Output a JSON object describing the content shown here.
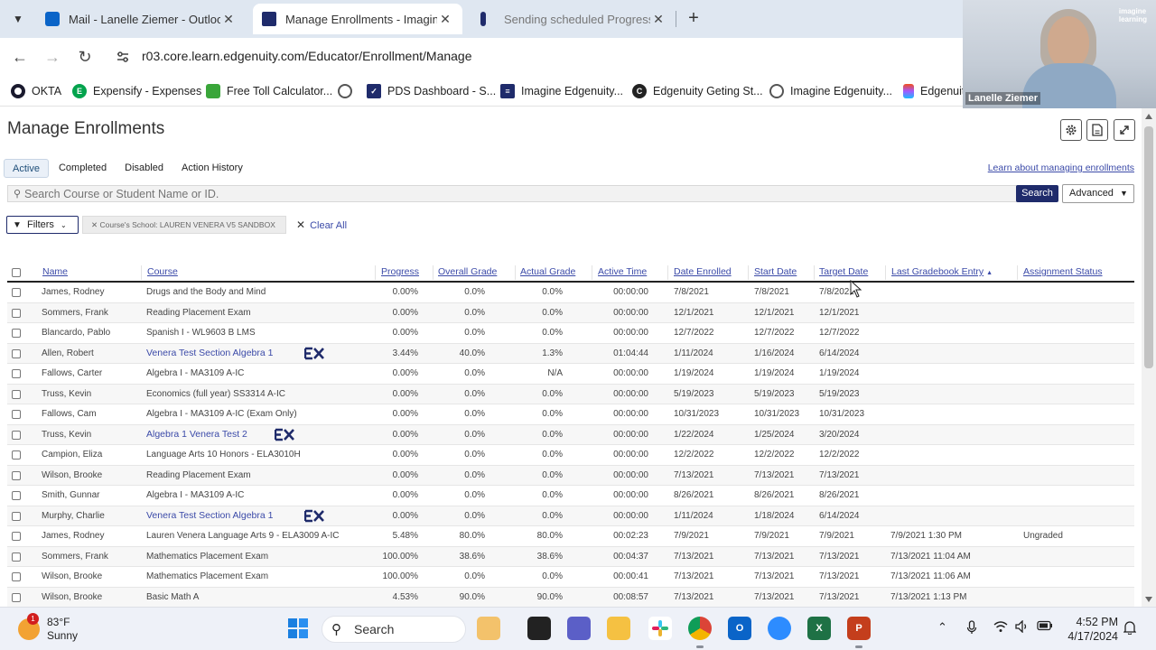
{
  "browser": {
    "tabs": [
      {
        "label": "Mail - Lanelle Ziemer - Outlook",
        "active": false,
        "icon": "outlook-icon"
      },
      {
        "label": "Manage Enrollments - Imagine",
        "active": true,
        "icon": "imagine-edgenuity-icon"
      },
      {
        "label": "Sending scheduled Progress Re",
        "active": false,
        "icon": "document-icon"
      }
    ],
    "url": "r03.core.learn.edgenuity.com/Educator/Enrollment/Manage",
    "bookmarks": [
      {
        "label": "OKTA",
        "icon": "okta-icon"
      },
      {
        "label": "Expensify - Expenses",
        "icon": "expensify-icon"
      },
      {
        "label": "Free Toll Calculator...",
        "icon": "toll-calculator-icon"
      },
      {
        "label": "",
        "icon": "globe-icon"
      },
      {
        "label": "PDS Dashboard - S...",
        "icon": "pds-dashboard-icon"
      },
      {
        "label": "Imagine Edgenuity...",
        "icon": "imagine-edgenuity-icon"
      },
      {
        "label": "Edgenuity Geting St...",
        "icon": "edgenuity-c-icon"
      },
      {
        "label": "Imagine Edgenuity...",
        "icon": "globe-icon"
      },
      {
        "label": "Edgenuit",
        "icon": "figma-icon"
      }
    ]
  },
  "webcam": {
    "name": "Lanelle Ziemer",
    "logo_line1": "imagine",
    "logo_line2": "learning"
  },
  "page": {
    "title": "Manage Enrollments",
    "tabs": [
      "Active",
      "Completed",
      "Disabled",
      "Action History"
    ],
    "learn_link": "Learn about managing enrollments",
    "search_placeholder": "Search Course or Student Name or ID.",
    "search_button": "Search",
    "advanced_button": "Advanced",
    "filters_button": "Filters",
    "filter_chip": "Course's School: LAUREN VENERA V5 SANDBOX",
    "clear_all": "Clear All"
  },
  "table": {
    "columns": [
      "Name",
      "Course",
      "Progress",
      "Overall Grade",
      "Actual Grade",
      "Active Time",
      "Date Enrolled",
      "Start Date",
      "Target Date",
      "Last Gradebook Entry",
      "Assignment Status"
    ],
    "sort_column": "Last Gradebook Entry",
    "rows": [
      {
        "name": "James, Rodney",
        "course": "Drugs and the Body and Mind",
        "course_link": false,
        "ex": false,
        "progress": "0.00%",
        "overall": "0.0%",
        "actual": "0.0%",
        "time": "00:00:00",
        "enrolled": "7/8/2021",
        "start": "7/8/2021",
        "target": "7/8/2021",
        "last": "",
        "status": ""
      },
      {
        "name": "Sommers, Frank",
        "course": "Reading Placement Exam",
        "course_link": false,
        "ex": false,
        "progress": "0.00%",
        "overall": "0.0%",
        "actual": "0.0%",
        "time": "00:00:00",
        "enrolled": "12/1/2021",
        "start": "12/1/2021",
        "target": "12/1/2021",
        "last": "",
        "status": ""
      },
      {
        "name": "Blancardo, Pablo",
        "course": "Spanish I - WL9603 B LMS",
        "course_link": false,
        "ex": false,
        "progress": "0.00%",
        "overall": "0.0%",
        "actual": "0.0%",
        "time": "00:00:00",
        "enrolled": "12/7/2022",
        "start": "12/7/2022",
        "target": "12/7/2022",
        "last": "",
        "status": ""
      },
      {
        "name": "Allen, Robert",
        "course": "Venera Test Section Algebra 1",
        "course_link": true,
        "ex": true,
        "progress": "3.44%",
        "overall": "40.0%",
        "actual": "1.3%",
        "time": "01:04:44",
        "enrolled": "1/11/2024",
        "start": "1/16/2024",
        "target": "6/14/2024",
        "last": "",
        "status": ""
      },
      {
        "name": "Fallows, Carter",
        "course": "Algebra I - MA3109 A-IC",
        "course_link": false,
        "ex": false,
        "progress": "0.00%",
        "overall": "0.0%",
        "actual": "N/A",
        "time": "00:00:00",
        "enrolled": "1/19/2024",
        "start": "1/19/2024",
        "target": "1/19/2024",
        "last": "",
        "status": ""
      },
      {
        "name": "Truss, Kevin",
        "course": "Economics (full year) SS3314 A-IC",
        "course_link": false,
        "ex": false,
        "progress": "0.00%",
        "overall": "0.0%",
        "actual": "0.0%",
        "time": "00:00:00",
        "enrolled": "5/19/2023",
        "start": "5/19/2023",
        "target": "5/19/2023",
        "last": "",
        "status": ""
      },
      {
        "name": "Fallows, Cam",
        "course": "Algebra I - MA3109 A-IC (Exam Only)",
        "course_link": false,
        "ex": false,
        "progress": "0.00%",
        "overall": "0.0%",
        "actual": "0.0%",
        "time": "00:00:00",
        "enrolled": "10/31/2023",
        "start": "10/31/2023",
        "target": "10/31/2023",
        "last": "",
        "status": ""
      },
      {
        "name": "Truss, Kevin",
        "course": "Algebra 1 Venera Test 2",
        "course_link": true,
        "ex": true,
        "progress": "0.00%",
        "overall": "0.0%",
        "actual": "0.0%",
        "time": "00:00:00",
        "enrolled": "1/22/2024",
        "start": "1/25/2024",
        "target": "3/20/2024",
        "last": "",
        "status": ""
      },
      {
        "name": "Campion, Eliza",
        "course": "Language Arts 10 Honors - ELA3010H",
        "course_link": false,
        "ex": false,
        "progress": "0.00%",
        "overall": "0.0%",
        "actual": "0.0%",
        "time": "00:00:00",
        "enrolled": "12/2/2022",
        "start": "12/2/2022",
        "target": "12/2/2022",
        "last": "",
        "status": ""
      },
      {
        "name": "Wilson, Brooke",
        "course": "Reading Placement Exam",
        "course_link": false,
        "ex": false,
        "progress": "0.00%",
        "overall": "0.0%",
        "actual": "0.0%",
        "time": "00:00:00",
        "enrolled": "7/13/2021",
        "start": "7/13/2021",
        "target": "7/13/2021",
        "last": "",
        "status": ""
      },
      {
        "name": "Smith, Gunnar",
        "course": "Algebra I - MA3109 A-IC",
        "course_link": false,
        "ex": false,
        "progress": "0.00%",
        "overall": "0.0%",
        "actual": "0.0%",
        "time": "00:00:00",
        "enrolled": "8/26/2021",
        "start": "8/26/2021",
        "target": "8/26/2021",
        "last": "",
        "status": ""
      },
      {
        "name": "Murphy, Charlie",
        "course": "Venera Test Section Algebra 1",
        "course_link": true,
        "ex": true,
        "progress": "0.00%",
        "overall": "0.0%",
        "actual": "0.0%",
        "time": "00:00:00",
        "enrolled": "1/11/2024",
        "start": "1/18/2024",
        "target": "6/14/2024",
        "last": "",
        "status": ""
      },
      {
        "name": "James, Rodney",
        "course": "Lauren Venera Language Arts 9 - ELA3009 A-IC",
        "course_link": false,
        "ex": false,
        "progress": "5.48%",
        "overall": "80.0%",
        "actual": "80.0%",
        "time": "00:02:23",
        "enrolled": "7/9/2021",
        "start": "7/9/2021",
        "target": "7/9/2021",
        "last": "7/9/2021 1:30 PM",
        "status": "Ungraded"
      },
      {
        "name": "Sommers, Frank",
        "course": "Mathematics Placement Exam",
        "course_link": false,
        "ex": false,
        "progress": "100.00%",
        "overall": "38.6%",
        "actual": "38.6%",
        "time": "00:04:37",
        "enrolled": "7/13/2021",
        "start": "7/13/2021",
        "target": "7/13/2021",
        "last": "7/13/2021 11:04 AM",
        "status": ""
      },
      {
        "name": "Wilson, Brooke",
        "course": "Mathematics Placement Exam",
        "course_link": false,
        "ex": false,
        "progress": "100.00%",
        "overall": "0.0%",
        "actual": "0.0%",
        "time": "00:00:41",
        "enrolled": "7/13/2021",
        "start": "7/13/2021",
        "target": "7/13/2021",
        "last": "7/13/2021 11:06 AM",
        "status": ""
      },
      {
        "name": "Wilson, Brooke",
        "course": "Basic Math A",
        "course_link": false,
        "ex": false,
        "progress": "4.53%",
        "overall": "90.0%",
        "actual": "90.0%",
        "time": "00:08:57",
        "enrolled": "7/13/2021",
        "start": "7/13/2021",
        "target": "7/13/2021",
        "last": "7/13/2021 1:13 PM",
        "status": ""
      }
    ]
  },
  "taskbar": {
    "weather_temp": "83°F",
    "weather_desc": "Sunny",
    "weather_badge": "1",
    "search_label": "Search",
    "time": "4:52 PM",
    "date": "4/17/2024",
    "apps": [
      "windows-start-icon",
      "search-icon",
      "paint-icon",
      "file-explorer-icon",
      "teams-icon",
      "folder-icon",
      "slack-icon",
      "chrome-icon",
      "outlook-new-icon",
      "zoom-icon",
      "excel-icon",
      "powerpoint-icon"
    ]
  },
  "colors": {
    "link": "#3b4aa8",
    "search_button": "#1f2b6b",
    "tabstrip": "#dfe7f1"
  }
}
